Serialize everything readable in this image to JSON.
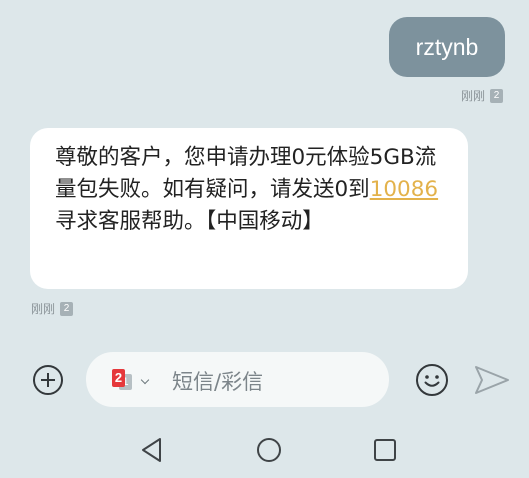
{
  "messages": {
    "outgoing": {
      "text": "rztynb",
      "time": "刚刚",
      "sim": "2"
    },
    "incoming": {
      "text_before": "尊敬的客户，您申请办理0元体验5GB流量包失败。如有疑问，请发送0到",
      "link_number": "10086",
      "text_after": "寻求客服帮助。【中国移动】",
      "time": "刚刚",
      "sim": "2"
    }
  },
  "composer": {
    "sim_selected": "2",
    "sim_other": "1",
    "placeholder": "短信/彩信"
  },
  "icons": {
    "add": "add-icon",
    "emoji": "emoji-icon",
    "send": "send-icon",
    "nav_back": "back-triangle-icon",
    "nav_home": "home-circle-icon",
    "nav_recent": "recent-square-icon"
  },
  "colors": {
    "background": "#dde7ea",
    "outgoing_bubble": "#7d929d",
    "incoming_bubble": "#ffffff",
    "link": "#e3b24b",
    "sim_badge_red": "#e5383b"
  }
}
